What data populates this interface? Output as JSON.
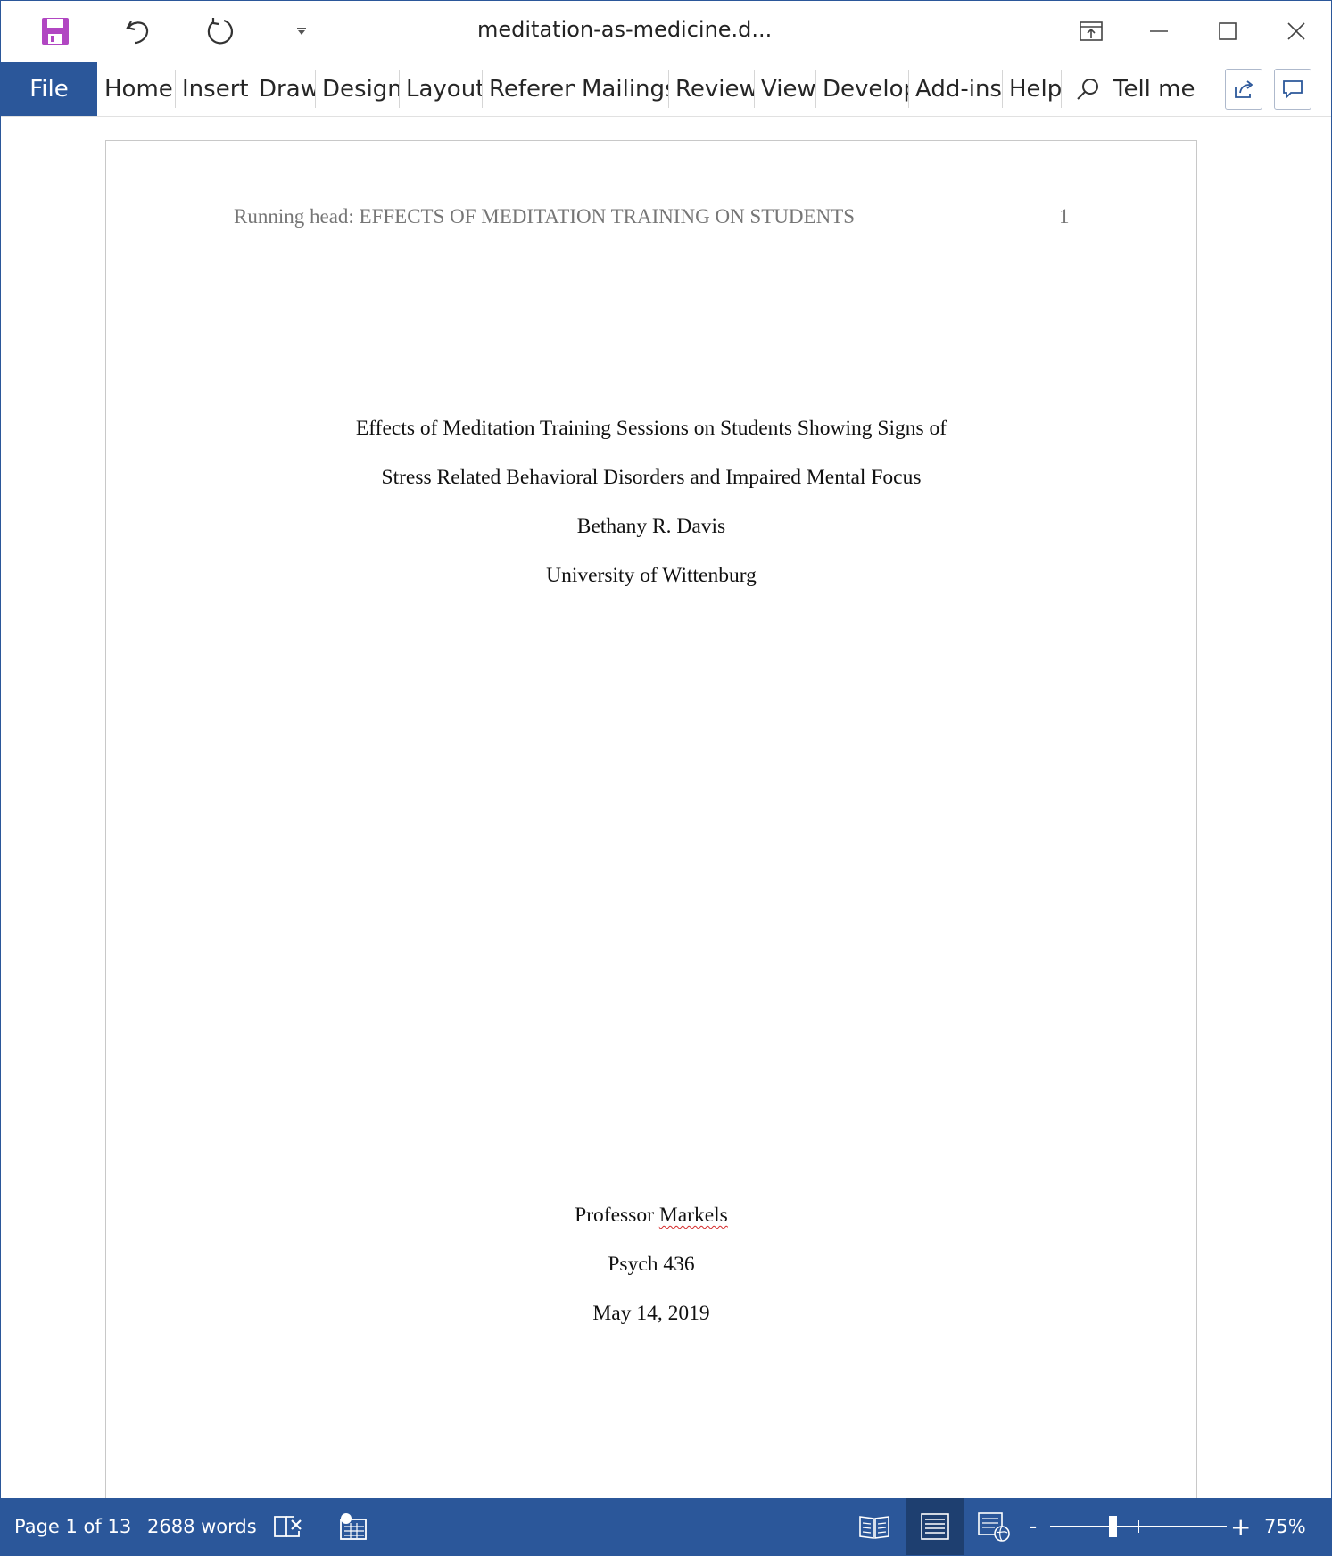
{
  "window": {
    "title": "meditation-as-medicine.d..."
  },
  "qat": {
    "save_icon": "save-icon",
    "undo_icon": "undo-icon",
    "redo_icon": "redo-icon",
    "customize_icon": "dropdown-arrow-icon"
  },
  "ribbon": {
    "file_label": "File",
    "tabs": [
      "Home",
      "Insert",
      "Draw",
      "Design",
      "Layout",
      "Referenc",
      "Mailings",
      "Review",
      "View",
      "Develop",
      "Add-ins",
      "Help"
    ],
    "tell_me": "Tell me"
  },
  "document": {
    "running_head": "Running head: EFFECTS OF MEDITATION TRAINING ON STUDENTS",
    "page_number": "1",
    "title_line1": "Effects of Meditation Training Sessions on Students Showing Signs of",
    "title_line2": "Stress Related Behavioral Disorders and Impaired Mental Focus",
    "author": "Bethany R. Davis",
    "institution": "University of Wittenburg",
    "professor_prefix": "Professor ",
    "professor_name": "Markels",
    "course": "Psych 436",
    "date": "May 14, 2019"
  },
  "status": {
    "page": "Page 1 of 13",
    "words": "2688 words",
    "zoom_minus": "-",
    "zoom_plus": "+",
    "zoom": "75%",
    "zoom_value_percent": 75
  },
  "colors": {
    "accent": "#2b579a",
    "save_icon": "#b146c2"
  }
}
